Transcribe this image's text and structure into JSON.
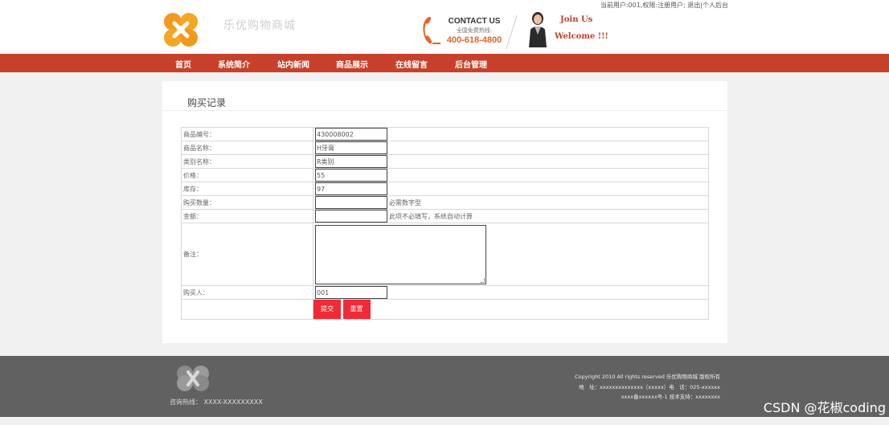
{
  "header": {
    "user_info": "当前用户:001,权限:注册用户;",
    "logout_link": "退出",
    "backend_link": "个人后台",
    "site_name": "乐优购物商城",
    "contact_title": "CONTACT US",
    "contact_sub": "全国免费热线:",
    "contact_phone": "400-618-4800",
    "join": "Join Us",
    "welcome": "Welcome !!!"
  },
  "nav": {
    "items": [
      "首页",
      "系统简介",
      "站内新闻",
      "商品展示",
      "在线留言",
      "后台管理"
    ]
  },
  "panel": {
    "title": "购买记录"
  },
  "form": {
    "product_id_label": "商品编号：",
    "product_id_value": "430008002",
    "product_name_label": "商品名称：",
    "product_name_value": "H牙膏",
    "category_label": "类别名称：",
    "category_value": "R类别",
    "price_label": "价格：",
    "price_value": "55",
    "stock_label": "库存：",
    "stock_value": "97",
    "quantity_label": "购买数量：",
    "quantity_value": "",
    "quantity_hint": "必需数字型",
    "amount_label": "金额：",
    "amount_value": "",
    "amount_hint": "此项不必填写，系统自动计算",
    "remark_label": "备注：",
    "buyer_label": "购买人：",
    "buyer_value": "001",
    "submit_label": "提交",
    "reset_label": "重置"
  },
  "footer": {
    "hotline": "咨询热线：  XXXX-XXXXXXXXX",
    "copyright": "Copyright 2010 All rights reserved 乐优购物商城 版权所有",
    "address": "地　址：xxxxxxxxxxxxxx（xxxxx）电　话：025-xxxxxx",
    "icp": "xxxx备xxxxxx号-1 技术支持：xxxxxxxx"
  },
  "watermark": "CSDN @花椒coding",
  "colors": {
    "nav_bg": "#c8402a",
    "button_bg": "#f02b37",
    "footer_bg": "#616161",
    "logo_orange": "#f39a1e"
  }
}
